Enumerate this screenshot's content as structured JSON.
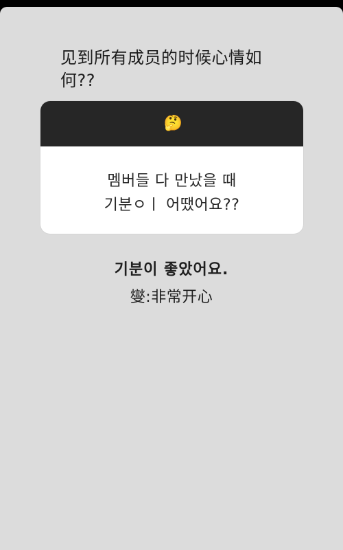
{
  "caption": "见到所有成员的时候心情如何??",
  "question_card": {
    "emoji": "🤔",
    "emoji_icon": "thinking-face-icon",
    "line1": "멤버들 다 만났을 때",
    "line2": "기분ㅇㅣ 어땠어요??"
  },
  "answer": {
    "korean": "기분이 좋았어요.",
    "chinese": "燮:非常开心"
  },
  "colors": {
    "background": "#dcdcdc",
    "card_header": "#262626",
    "card_body": "#ffffff",
    "text": "#1e1e1e"
  }
}
